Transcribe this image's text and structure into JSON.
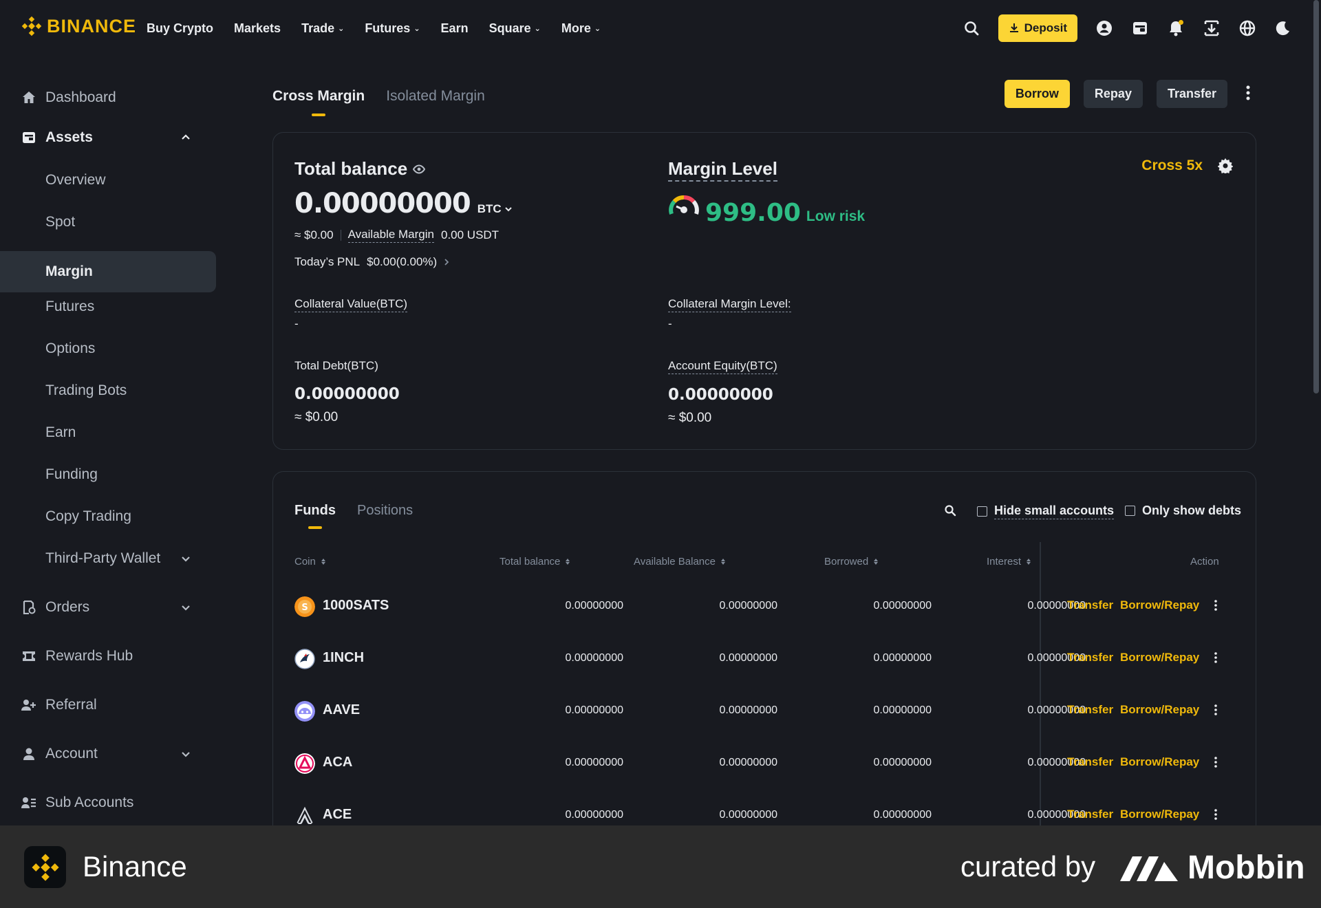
{
  "brand": {
    "name": "BINANCE",
    "accent": "#f0b90b"
  },
  "nav": {
    "links": [
      {
        "label": "Buy Crypto",
        "dropdown": false
      },
      {
        "label": "Markets",
        "dropdown": false
      },
      {
        "label": "Trade",
        "dropdown": true
      },
      {
        "label": "Futures",
        "dropdown": true
      },
      {
        "label": "Earn",
        "dropdown": false
      },
      {
        "label": "Square",
        "dropdown": true
      },
      {
        "label": "More",
        "dropdown": true
      }
    ],
    "deposit_label": "Deposit",
    "icons": [
      "search-icon",
      "user-icon",
      "wallet-icon",
      "bell-icon",
      "download-app-icon",
      "globe-icon",
      "moon-icon"
    ]
  },
  "sidebar": {
    "items": [
      {
        "label": "Dashboard",
        "icon": "home-icon"
      },
      {
        "label": "Assets",
        "icon": "wallet-icon",
        "expanded": true
      },
      {
        "label": "Overview"
      },
      {
        "label": "Spot"
      },
      {
        "label": "Margin",
        "active": true
      },
      {
        "label": "Futures"
      },
      {
        "label": "Options"
      },
      {
        "label": "Trading Bots"
      },
      {
        "label": "Earn"
      },
      {
        "label": "Funding"
      },
      {
        "label": "Copy Trading"
      },
      {
        "label": "Third-Party Wallet"
      },
      {
        "label": "Orders",
        "icon": "orders-icon"
      },
      {
        "label": "Rewards Hub",
        "icon": "ticket-icon"
      },
      {
        "label": "Referral",
        "icon": "add-user-icon"
      },
      {
        "label": "Account",
        "icon": "account-icon"
      },
      {
        "label": "Sub Accounts",
        "icon": "sub-accounts-icon"
      }
    ]
  },
  "main": {
    "tabs": [
      {
        "label": "Cross Margin",
        "active": true
      },
      {
        "label": "Isolated Margin",
        "active": false
      }
    ],
    "buttons": {
      "borrow": "Borrow",
      "repay": "Repay",
      "transfer": "Transfer"
    },
    "balance": {
      "title": "Total balance",
      "amount": "0.00000000",
      "currency": "BTC",
      "usd": "≈ $0.00",
      "available_margin_label": "Available Margin",
      "available_margin_value": "0.00 USDT",
      "pnl_label": "Today’s PNL",
      "pnl_value": "$0.00(0.00%)"
    },
    "margin_level": {
      "title": "Margin Level",
      "value": "999.00",
      "risk": "Low risk",
      "cross_leverage": "Cross 5x"
    },
    "collateral_value": {
      "label": "Collateral Value(BTC)",
      "value": "-"
    },
    "collateral_margin_level": {
      "label": "Collateral Margin Level:",
      "value": "-"
    },
    "total_debt": {
      "label": "Total Debt(BTC)",
      "value": "0.00000000",
      "usd": "≈ $0.00"
    },
    "account_equity": {
      "label": "Account Equity(BTC)",
      "value": "0.00000000",
      "usd": "≈ $0.00"
    }
  },
  "funds": {
    "tabs": [
      {
        "label": "Funds",
        "active": true
      },
      {
        "label": "Positions",
        "active": false
      }
    ],
    "hide_small": "Hide small accounts",
    "only_debts": "Only show debts",
    "columns": [
      "Coin",
      "Total balance",
      "Available Balance",
      "Borrowed",
      "Interest",
      "Action"
    ],
    "rows": [
      {
        "coin": "1000SATS",
        "total": "0.00000000",
        "available": "0.00000000",
        "borrowed": "0.00000000",
        "interest": "0.00000000"
      },
      {
        "coin": "1INCH",
        "total": "0.00000000",
        "available": "0.00000000",
        "borrowed": "0.00000000",
        "interest": "0.00000000"
      },
      {
        "coin": "AAVE",
        "total": "0.00000000",
        "available": "0.00000000",
        "borrowed": "0.00000000",
        "interest": "0.00000000"
      },
      {
        "coin": "ACA",
        "total": "0.00000000",
        "available": "0.00000000",
        "borrowed": "0.00000000",
        "interest": "0.00000000"
      },
      {
        "coin": "ACE",
        "total": "0.00000000",
        "available": "0.00000000",
        "borrowed": "0.00000000",
        "interest": "0.00000000"
      }
    ],
    "action_transfer": "Transfer",
    "action_borrow_repay": "Borrow/Repay"
  },
  "footer": {
    "app_name": "Binance",
    "curated": "curated by",
    "mobbin": "Mobbin"
  }
}
